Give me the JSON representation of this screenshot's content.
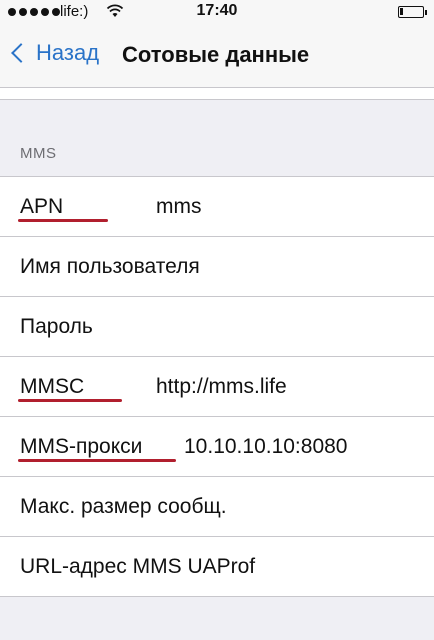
{
  "status_bar": {
    "carrier": "life:)",
    "time": "17:40"
  },
  "nav": {
    "back_label": "Назад",
    "title": "Сотовые данные"
  },
  "section": {
    "header": "MMS"
  },
  "rows": [
    {
      "label": "APN",
      "value": "mms",
      "highlighted": true
    },
    {
      "label": "Имя пользователя",
      "value": ""
    },
    {
      "label": "Пароль",
      "value": ""
    },
    {
      "label": "MMSC",
      "value": "http://mms.life",
      "highlighted": true
    },
    {
      "label": "MMS-прокси",
      "value": "10.10.10.10:8080",
      "highlighted": true
    },
    {
      "label": "Макс. размер сообщ.",
      "value": ""
    },
    {
      "label": "URL-адрес MMS UAProf",
      "value": ""
    }
  ],
  "colors": {
    "accent": "#2a73c8",
    "highlight_underline": "#b11f2e",
    "background": "#efeff4"
  },
  "icons": [
    "signal-dots-icon",
    "wifi-icon",
    "battery-icon",
    "chevron-left-icon"
  ]
}
